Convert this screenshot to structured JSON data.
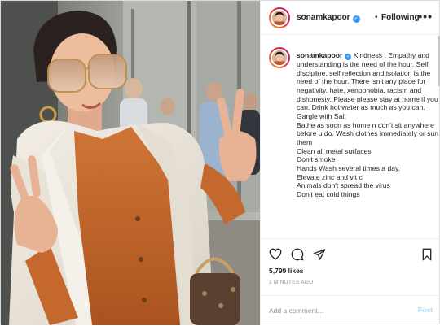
{
  "post": {
    "username": "sonamkapoor",
    "verified": true,
    "follow_status": "Following",
    "separator": "•",
    "more_label": "•••"
  },
  "caption": {
    "username": "sonamkapoor",
    "lines": [
      "Kindness , Empathy and understanding is the need of the hour. Self discipline, self reflection and isolation is the need of the hour. There isn't any place for negativity, hate, xenophobia, racism and dishonesty. Please please stay at home if you can. Drink hot water as much as you can.",
      "Gargle with Salt",
      "Bathe as soon as home n don't sit anywhere before u do. Wash clothes immediately or sun them",
      "Clean all metal surfaces",
      "Don't smoke",
      "Hands Wash several times a day.",
      "Elevate zinc and vit c",
      "Animals don't spread the virus",
      "Don't eat cold things"
    ]
  },
  "actions": {
    "like_icon": "heart-icon",
    "comment_icon": "comment-icon",
    "share_icon": "paper-plane-icon",
    "save_icon": "bookmark-icon",
    "likes": "5,799 likes",
    "time_ago": "2 MINUTES AGO"
  },
  "comment": {
    "placeholder": "Add a comment…",
    "post_label": "Post"
  },
  "colors": {
    "verified": "#3897f0",
    "post_button_disabled": "#b2dffc",
    "border": "#dbdbdb",
    "muted_text": "#8e8e8e",
    "jacket": "#ece6db",
    "blouse": "#c4682e"
  }
}
